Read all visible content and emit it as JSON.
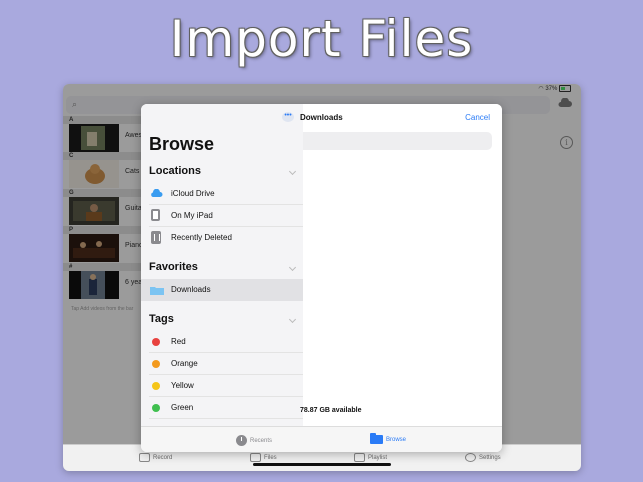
{
  "headline": "Import Files",
  "status": {
    "battery": "37%"
  },
  "library": {
    "sections": [
      {
        "letter": "A",
        "title": "Awes"
      },
      {
        "letter": "C",
        "title": "Cats"
      },
      {
        "letter": "G",
        "title": "Guita"
      },
      {
        "letter": "P",
        "title": "Piano"
      },
      {
        "letter": "#",
        "title": "6 yea"
      }
    ],
    "hint": "Tap  Add videos from the bar"
  },
  "tabbar": {
    "record": "Record",
    "files": "Files",
    "playlist": "Playlist",
    "settings": "Settings"
  },
  "picker": {
    "sidebar_title": "Browse",
    "locations_header": "Locations",
    "locations": [
      "iCloud Drive",
      "On My iPad",
      "Recently Deleted"
    ],
    "favorites_header": "Favorites",
    "favorites": [
      "Downloads"
    ],
    "tags_header": "Tags",
    "tags": [
      {
        "name": "Red",
        "color": "#e8423f"
      },
      {
        "name": "Orange",
        "color": "#f39a1e"
      },
      {
        "name": "Yellow",
        "color": "#f5c518"
      },
      {
        "name": "Green",
        "color": "#3fbf4f"
      }
    ],
    "folder_title": "Downloads",
    "cancel": "Cancel",
    "storage": "78.87 GB available",
    "tabs": {
      "recents": "Recents",
      "browse": "Browse"
    }
  },
  "colors": {
    "accent": "#2a7bf6",
    "background": "#a9a9de"
  }
}
